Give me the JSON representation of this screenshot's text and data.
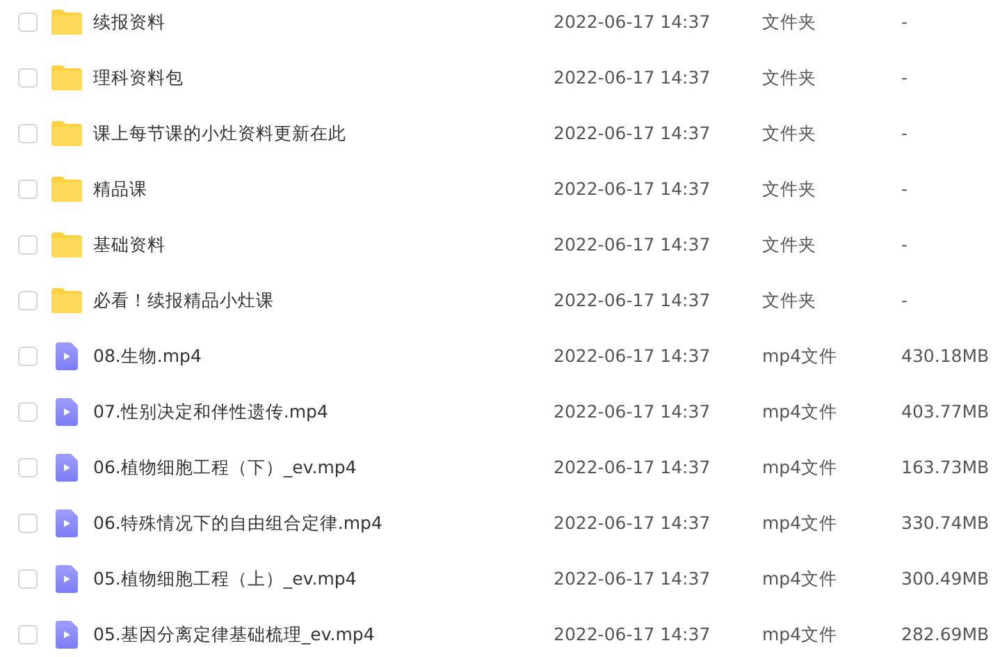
{
  "files": [
    {
      "kind": "folder",
      "checked": false,
      "name": "续报资料",
      "modified": "2022-06-17 14:37",
      "type": "文件夹",
      "size": "-"
    },
    {
      "kind": "folder",
      "checked": false,
      "name": "理科资料包",
      "modified": "2022-06-17 14:37",
      "type": "文件夹",
      "size": "-"
    },
    {
      "kind": "folder",
      "checked": false,
      "name": "课上每节课的小灶资料更新在此",
      "modified": "2022-06-17 14:37",
      "type": "文件夹",
      "size": "-"
    },
    {
      "kind": "folder",
      "checked": false,
      "name": "精品课",
      "modified": "2022-06-17 14:37",
      "type": "文件夹",
      "size": "-"
    },
    {
      "kind": "folder",
      "checked": false,
      "name": "基础资料",
      "modified": "2022-06-17 14:37",
      "type": "文件夹",
      "size": "-"
    },
    {
      "kind": "folder",
      "checked": false,
      "name": "必看！续报精品小灶课",
      "modified": "2022-06-17 14:37",
      "type": "文件夹",
      "size": "-"
    },
    {
      "kind": "video",
      "checked": false,
      "name": "08.生物.mp4",
      "modified": "2022-06-17 14:37",
      "type": "mp4文件",
      "size": "430.18MB"
    },
    {
      "kind": "video",
      "checked": false,
      "name": "07.性别决定和伴性遗传.mp4",
      "modified": "2022-06-17 14:37",
      "type": "mp4文件",
      "size": "403.77MB"
    },
    {
      "kind": "video",
      "checked": false,
      "name": "06.植物细胞工程（下）_ev.mp4",
      "modified": "2022-06-17 14:37",
      "type": "mp4文件",
      "size": "163.73MB"
    },
    {
      "kind": "video",
      "checked": false,
      "name": "06.特殊情况下的自由组合定律.mp4",
      "modified": "2022-06-17 14:37",
      "type": "mp4文件",
      "size": "330.74MB"
    },
    {
      "kind": "video",
      "checked": false,
      "name": "05.植物细胞工程（上）_ev.mp4",
      "modified": "2022-06-17 14:37",
      "type": "mp4文件",
      "size": "300.49MB"
    },
    {
      "kind": "video",
      "checked": false,
      "name": "05.基因分离定律基础梳理_ev.mp4",
      "modified": "2022-06-17 14:37",
      "type": "mp4文件",
      "size": "282.69MB"
    }
  ]
}
